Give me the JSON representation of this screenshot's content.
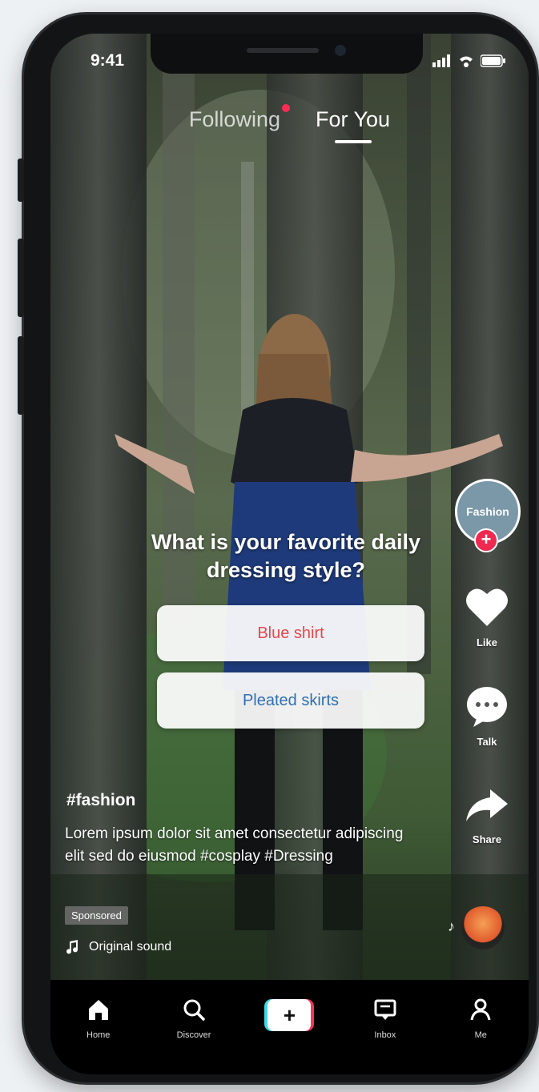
{
  "status_bar": {
    "time": "9:41"
  },
  "top_tabs": [
    {
      "label": "Following",
      "has_dot": true,
      "active": false
    },
    {
      "label": "For You",
      "has_dot": false,
      "active": true
    }
  ],
  "poll": {
    "question": "What is your favorite daily dressing style?",
    "options": [
      "Blue shirt",
      "Pleated skirts"
    ],
    "option_colors": [
      "#e8474a",
      "#2f6fb4"
    ]
  },
  "right_rail": {
    "avatar_label": "Fashion",
    "like_count": "Like",
    "comment_count": "Talk",
    "share_count": "Share"
  },
  "post": {
    "username": "#fashion",
    "description": "Lorem ipsum dolor sit amet consectetur adipiscing elit sed do eiusmod #cosplay #Dressing",
    "chip": "Sponsored",
    "music": "Original sound"
  },
  "bottom_nav": [
    {
      "label": "Home",
      "icon": "home-icon"
    },
    {
      "label": "Discover",
      "icon": "search-icon"
    },
    {
      "label": "",
      "icon": "create-plus-icon"
    },
    {
      "label": "Inbox",
      "icon": "inbox-icon"
    },
    {
      "label": "Me",
      "icon": "profile-icon"
    }
  ],
  "colors": {
    "accent_red": "#fe2c55",
    "accent_cyan": "#3bd9e6"
  }
}
